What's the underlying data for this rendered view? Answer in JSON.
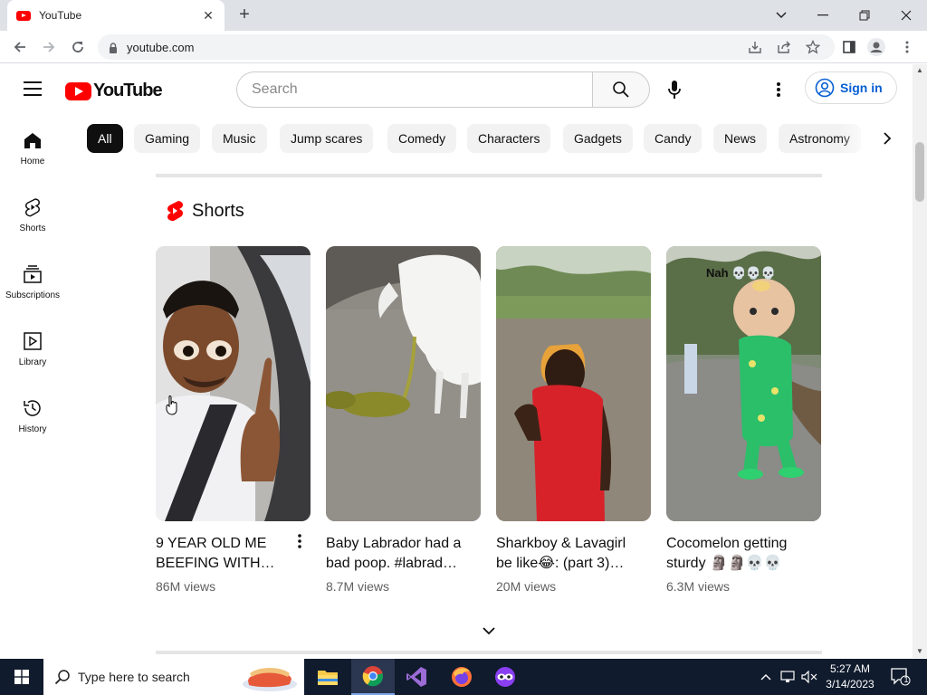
{
  "browser": {
    "tab_title": "YouTube",
    "url": "youtube.com"
  },
  "masthead": {
    "logo_text": "YouTube",
    "search_placeholder": "Search",
    "signin_label": "Sign in"
  },
  "guide": {
    "items": [
      {
        "label": "Home",
        "icon": "home-icon"
      },
      {
        "label": "Shorts",
        "icon": "shorts-icon"
      },
      {
        "label": "Subscriptions",
        "icon": "subscriptions-icon"
      },
      {
        "label": "Library",
        "icon": "library-icon"
      },
      {
        "label": "History",
        "icon": "history-icon"
      }
    ]
  },
  "chips": [
    "All",
    "Gaming",
    "Music",
    "Jump scares",
    "Comedy",
    "Characters",
    "Gadgets",
    "Candy",
    "News",
    "Astronomy"
  ],
  "shorts": {
    "heading": "Shorts",
    "items": [
      {
        "title": "9 YEAR OLD ME BEEFING WITH…",
        "views": "86M views"
      },
      {
        "title": "Baby Labrador had a bad poop. #labrad…",
        "views": "8.7M views"
      },
      {
        "title": "Sharkboy & Lavagirl be like😂: (part 3)…",
        "views": "20M views"
      },
      {
        "title": "Cocomelon getting sturdy 🗿🗿💀💀",
        "views": "6.3M views",
        "overlay": "Nah 💀💀💀"
      }
    ]
  },
  "taskbar": {
    "search_placeholder": "Type here to search",
    "time": "5:27 AM",
    "date": "3/14/2023",
    "notification_count": "1"
  },
  "colors": {
    "brand_red": "#ff0000",
    "link_blue": "#065fd4",
    "taskbar_bg": "#101b2d"
  }
}
